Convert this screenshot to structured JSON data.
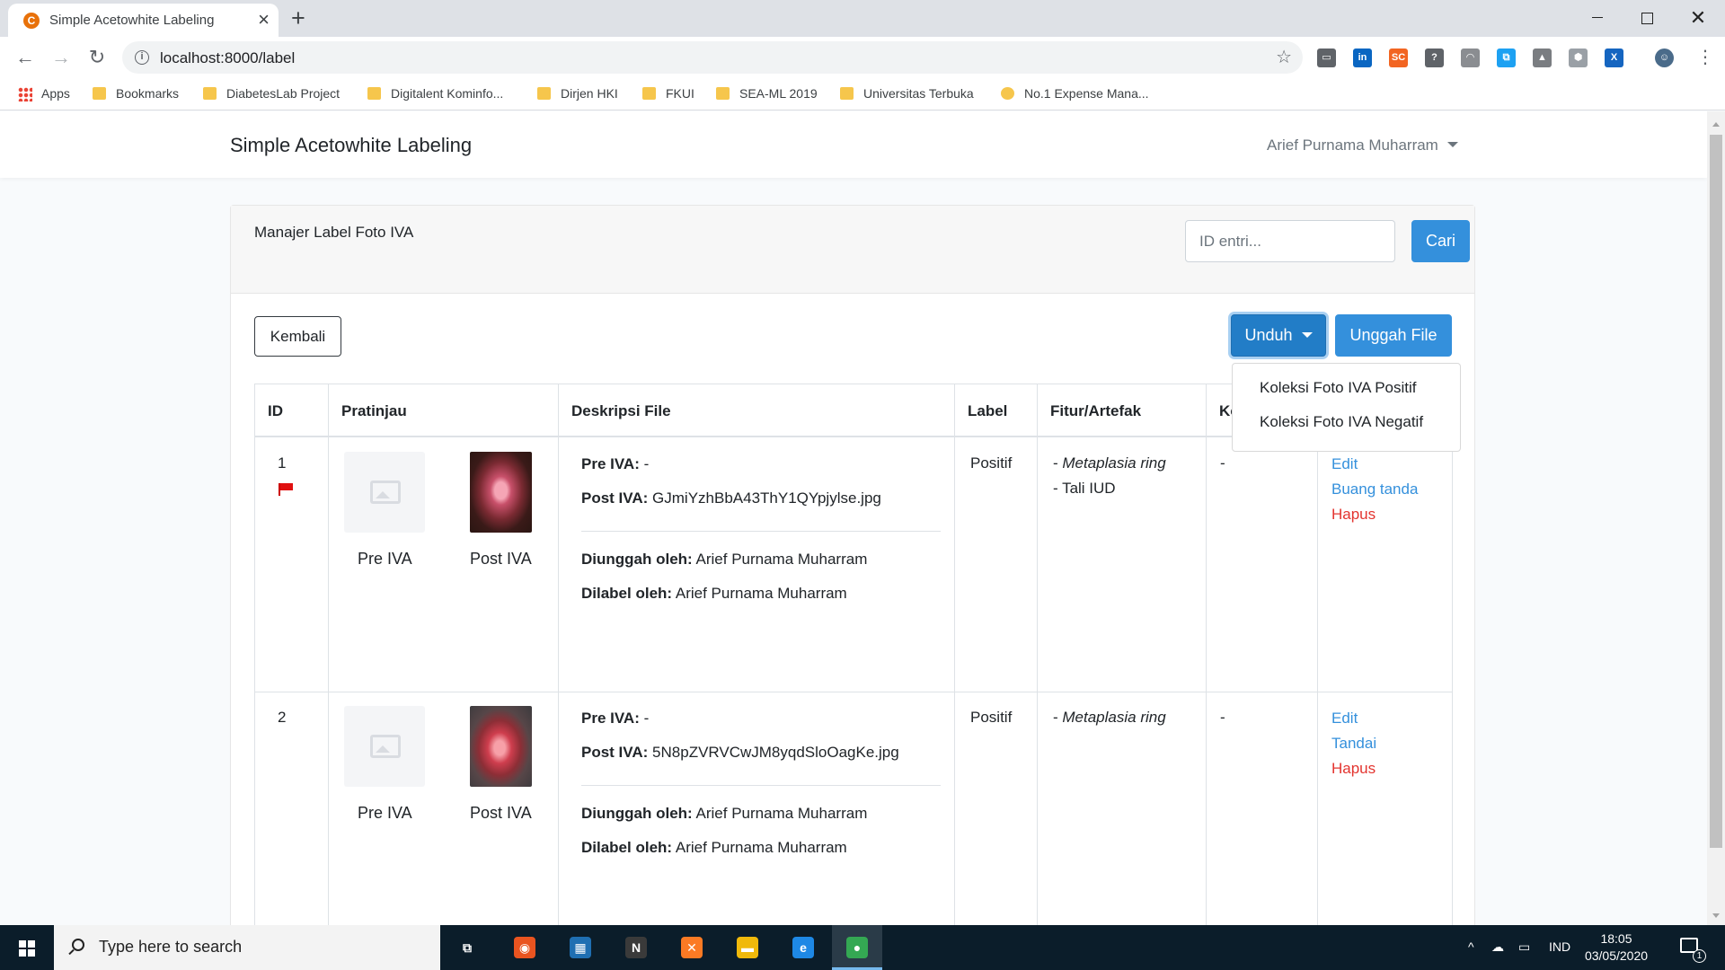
{
  "browser": {
    "tab_title": "Simple Acetowhite Labeling",
    "tab_favicon": "C",
    "new_tab_label": "+",
    "url": "localhost:8000/label",
    "extension_icons": [
      {
        "name": "chat-extension-icon",
        "glyph": "▭",
        "color": "#5f6368"
      },
      {
        "name": "linkedin-icon",
        "glyph": "in",
        "color": "#0a66c2"
      },
      {
        "name": "sc-extension-icon",
        "glyph": "SC",
        "color": "#f26522"
      },
      {
        "name": "help-extension-icon",
        "glyph": "?",
        "color": "#5f6368"
      },
      {
        "name": "headphones-extension-icon",
        "glyph": "◠",
        "color": "#8a8d91"
      },
      {
        "name": "translate-extension-icon",
        "glyph": "⧉",
        "color": "#1da1f2"
      },
      {
        "name": "drive-extension-icon",
        "glyph": "▲",
        "color": "#7a7d81"
      },
      {
        "name": "shield-extension-icon",
        "glyph": "⬢",
        "color": "#9aa0a6"
      },
      {
        "name": "x-extension-icon",
        "glyph": "X",
        "color": "#1565c0"
      }
    ],
    "bookmarks": [
      {
        "label": "Apps",
        "type": "apps"
      },
      {
        "label": "Bookmarks",
        "type": "folder"
      },
      {
        "label": "DiabetesLab Project",
        "type": "folder"
      },
      {
        "label": "Digitalent Kominfo...",
        "type": "folder"
      },
      {
        "label": "Dirjen HKI",
        "type": "folder"
      },
      {
        "label": "FKUI",
        "type": "folder"
      },
      {
        "label": "SEA-ML 2019",
        "type": "folder"
      },
      {
        "label": "Universitas Terbuka",
        "type": "folder"
      },
      {
        "label": "No.1 Expense Mana...",
        "type": "site"
      }
    ]
  },
  "navbar": {
    "brand": "Simple Acetowhite Labeling",
    "user": "Arief Purnama Muharram"
  },
  "card": {
    "title": "Manajer Label Foto IVA",
    "search_placeholder": "ID entri...",
    "search_button": "Cari",
    "back_button": "Kembali",
    "download_button": "Unduh",
    "upload_button": "Unggah File",
    "download_menu": [
      "Koleksi Foto IVA Positif",
      "Koleksi Foto IVA Negatif"
    ]
  },
  "table": {
    "headers": [
      "ID",
      "Pratinjau",
      "Deskripsi File",
      "Label",
      "Fitur/Artefak",
      "Ko"
    ],
    "rows": [
      {
        "id": "1",
        "flagged": true,
        "pre_label": "Pre IVA",
        "post_label": "Post IVA",
        "pre_key": "Pre IVA:",
        "pre_value": "-",
        "post_key": "Post IVA:",
        "post_value": "GJmiYzhBbA43ThY1QYpjylse.jpg",
        "uploaded_key": "Diunggah oleh:",
        "uploaded_value": "Arief Purnama Muharram",
        "labeled_key": "Dilabel oleh:",
        "labeled_value": "Arief Purnama Muharram",
        "label": "Positif",
        "features": [
          "Metaplasia ring",
          "Tali IUD"
        ],
        "features_italic": [
          true,
          false
        ],
        "comment": "-",
        "actions": [
          {
            "label": "Edit",
            "style": "link"
          },
          {
            "label": "Buang tanda",
            "style": "link"
          },
          {
            "label": "Hapus",
            "style": "danger"
          }
        ]
      },
      {
        "id": "2",
        "flagged": false,
        "pre_label": "Pre IVA",
        "post_label": "Post IVA",
        "pre_key": "Pre IVA:",
        "pre_value": "-",
        "post_key": "Post IVA:",
        "post_value": "5N8pZVRVCwJM8yqdSloOagKe.jpg",
        "uploaded_key": "Diunggah oleh:",
        "uploaded_value": "Arief Purnama Muharram",
        "labeled_key": "Dilabel oleh:",
        "labeled_value": "Arief Purnama Muharram",
        "label": "Positif",
        "features": [
          "Metaplasia ring"
        ],
        "features_italic": [
          true
        ],
        "comment": "-",
        "actions": [
          {
            "label": "Edit",
            "style": "link"
          },
          {
            "label": "Tandai",
            "style": "link"
          },
          {
            "label": "Hapus",
            "style": "danger"
          }
        ]
      }
    ]
  },
  "taskbar": {
    "search_placeholder": "Type here to search",
    "apps": [
      {
        "name": "task-view-icon",
        "glyph": "⧉",
        "color": "transparent"
      },
      {
        "name": "ubuntu-icon",
        "glyph": "◉",
        "color": "#e95420"
      },
      {
        "name": "store-icon",
        "glyph": "▦",
        "color": "#1f6fb2"
      },
      {
        "name": "notion-icon",
        "glyph": "N",
        "color": "#3a3a3a"
      },
      {
        "name": "xampp-icon",
        "glyph": "✕",
        "color": "#fb7a24"
      },
      {
        "name": "file-explorer-icon",
        "glyph": "▬",
        "color": "#f0b90b"
      },
      {
        "name": "edge-icon",
        "glyph": "e",
        "color": "#1e88e5"
      },
      {
        "name": "chrome-icon",
        "glyph": "●",
        "color": "#34a853"
      }
    ],
    "tray_arrow": "^",
    "language": "IND",
    "time": "18:05",
    "date": "03/05/2020",
    "notification_count": "1"
  }
}
